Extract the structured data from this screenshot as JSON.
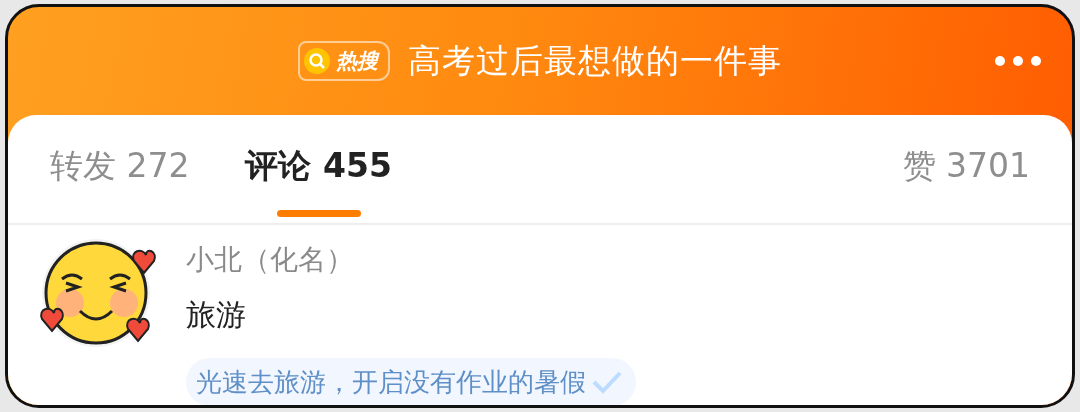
{
  "header": {
    "badge": "热搜",
    "title": "高考过后最想做的一件事"
  },
  "tabs": [
    {
      "label": "转发 272",
      "selected": false
    },
    {
      "label": "评论 455",
      "selected": true
    },
    {
      "label": "赞 3701",
      "selected": false
    }
  ],
  "comment": {
    "author": "小北（化名）",
    "text": "旅游",
    "tag": {
      "label": "光速去旅游，开启没有作业的暑假",
      "checked": true
    }
  }
}
